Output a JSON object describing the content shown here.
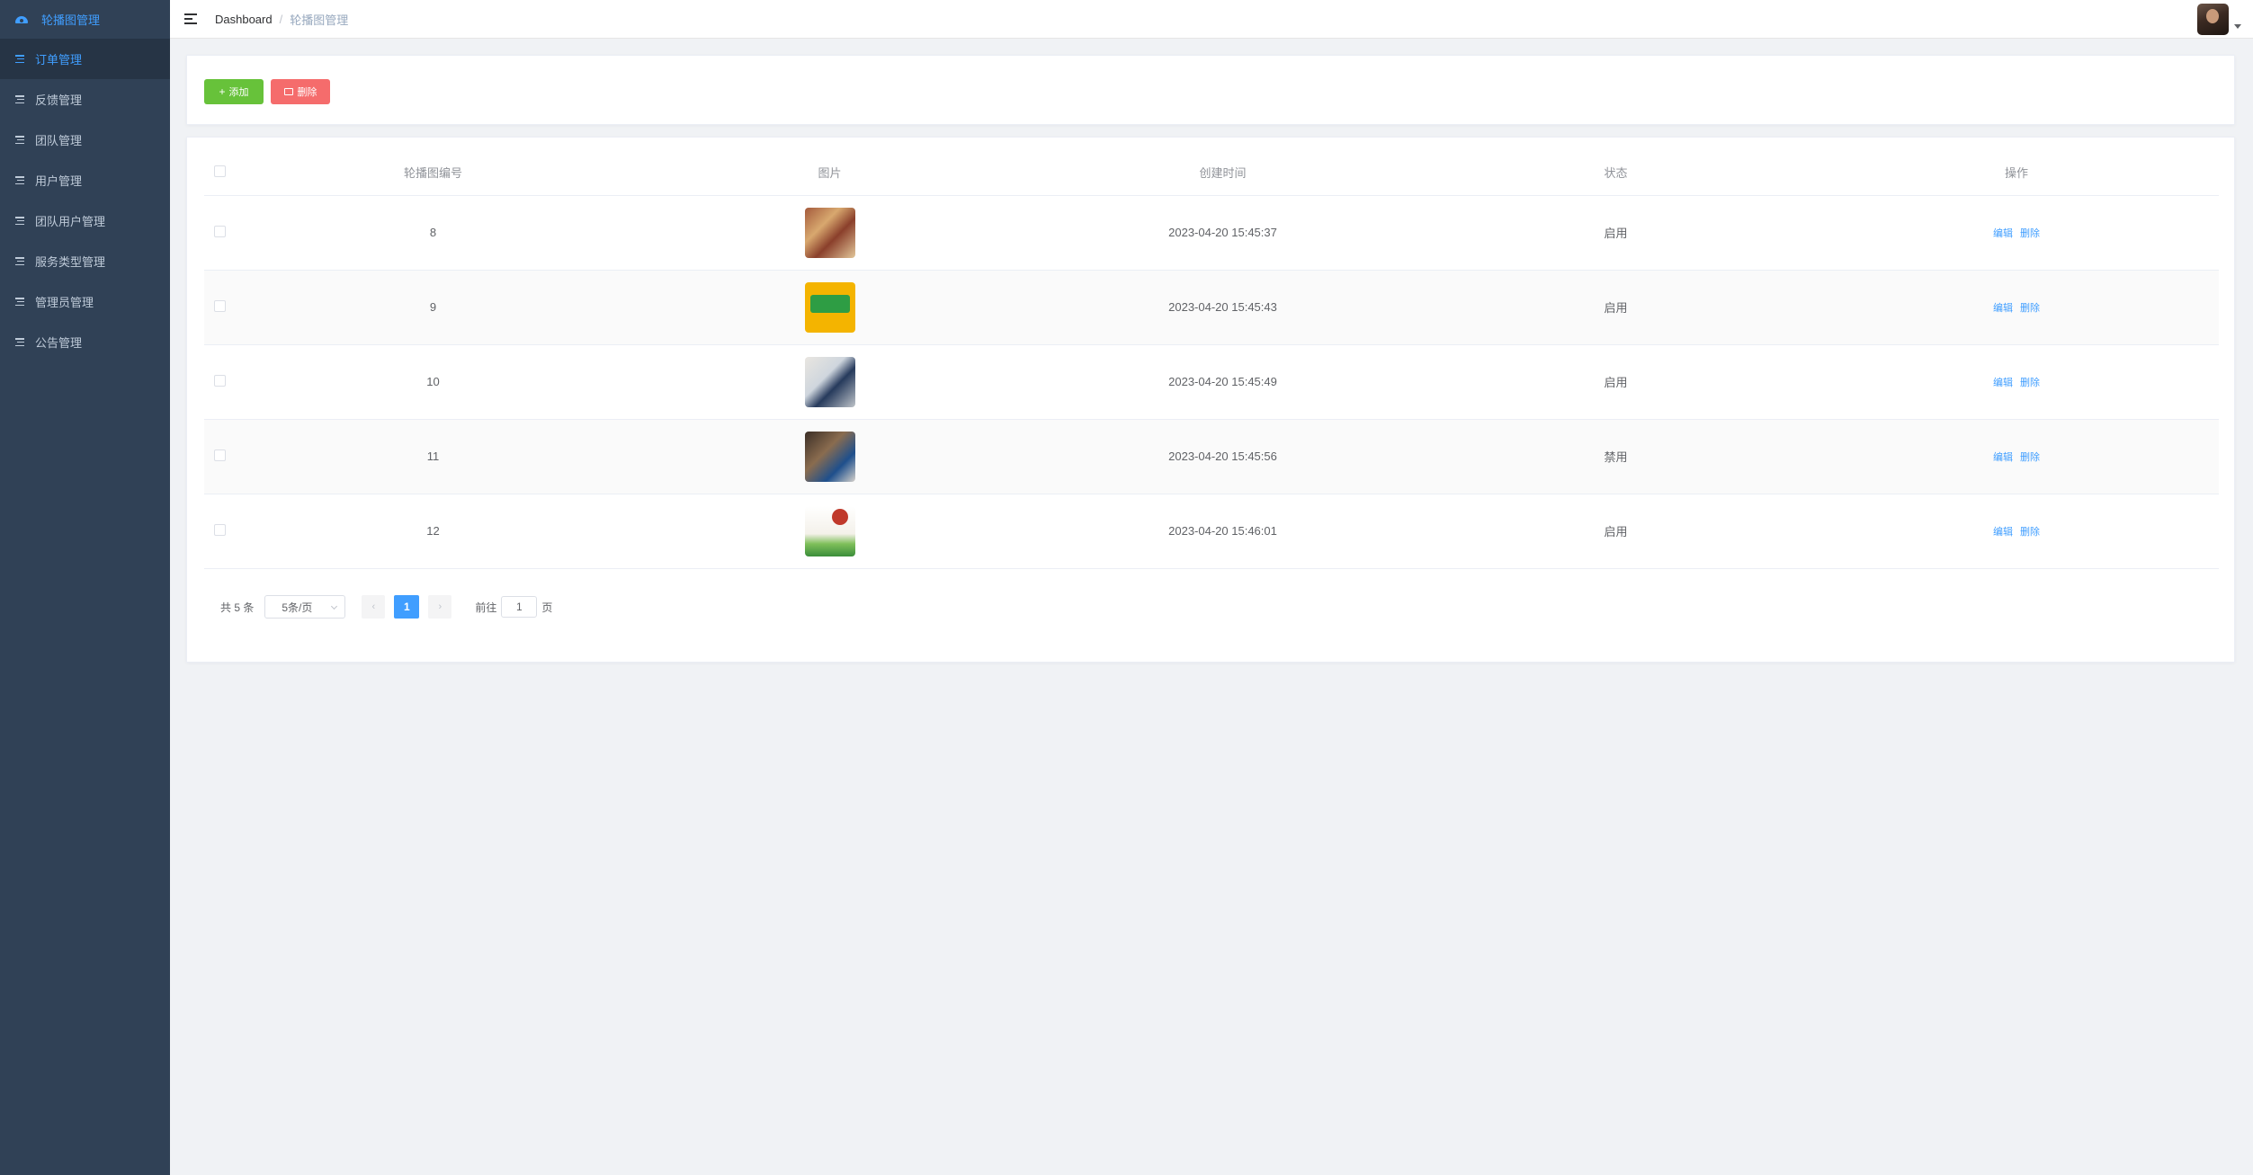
{
  "sidebar": {
    "header": "轮播图管理",
    "items": [
      {
        "label": "订单管理",
        "active": true
      },
      {
        "label": "反馈管理",
        "active": false
      },
      {
        "label": "团队管理",
        "active": false
      },
      {
        "label": "用户管理",
        "active": false
      },
      {
        "label": "团队用户管理",
        "active": false
      },
      {
        "label": "服务类型管理",
        "active": false
      },
      {
        "label": "管理员管理",
        "active": false
      },
      {
        "label": "公告管理",
        "active": false
      }
    ]
  },
  "navbar": {
    "breadcrumb": {
      "home": "Dashboard",
      "separator": "/",
      "current": "轮播图管理"
    }
  },
  "toolbar": {
    "add_label": "添加",
    "delete_label": "删除"
  },
  "table": {
    "headers": [
      "轮播图编号",
      "图片",
      "创建时间",
      "状态",
      "操作"
    ],
    "rows": [
      {
        "id": "8",
        "image": "photo-1",
        "created": "2023-04-20 15:45:37",
        "status": "启用"
      },
      {
        "id": "9",
        "image": "photo-2",
        "created": "2023-04-20 15:45:43",
        "status": "启用"
      },
      {
        "id": "10",
        "image": "photo-3",
        "created": "2023-04-20 15:45:49",
        "status": "启用"
      },
      {
        "id": "11",
        "image": "photo-4",
        "created": "2023-04-20 15:45:56",
        "status": "禁用"
      },
      {
        "id": "12",
        "image": "photo-5",
        "created": "2023-04-20 15:46:01",
        "status": "启用"
      }
    ],
    "actions": {
      "edit": "编辑",
      "delete": "删除"
    }
  },
  "pagination": {
    "total": "共 5 条",
    "page_size": "5条/页",
    "prev": "‹",
    "next": "›",
    "current_page": "1",
    "goto_prefix": "前往",
    "goto_value": "1",
    "goto_suffix": "页"
  },
  "colors": {
    "sidebar_bg": "#304156",
    "sidebar_active_bg": "#263445",
    "primary": "#409eff",
    "success": "#67c23a",
    "danger": "#f56c6c"
  }
}
